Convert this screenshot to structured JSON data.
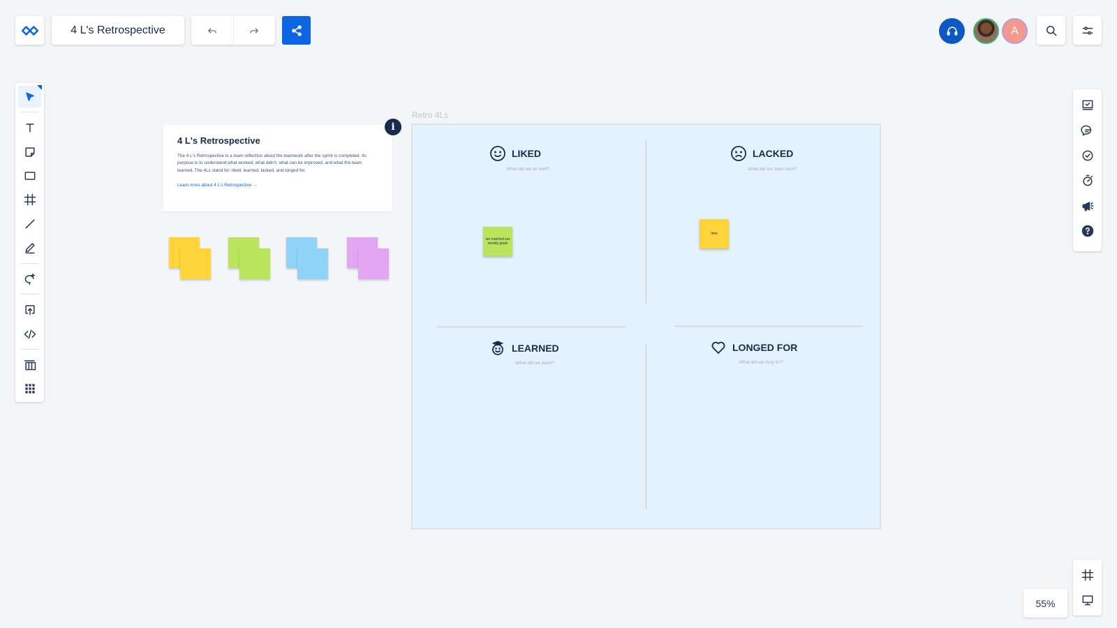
{
  "header": {
    "board_title": "4 L's Retrospective",
    "avatar_initial": "A"
  },
  "zoom_level": "55%",
  "description": {
    "title": "4 L's Retrospective",
    "body": "The 4 L's Retrospective is a team reflection about the teamwork after the sprint is completed. Its purpose is to understand what worked, what didn't, what can be improved, and what the team learned. The 4Ls stand for: liked, learned, lacked, and longed for.",
    "link": "Learn more about 4 L's Retrospective →"
  },
  "sticky_stack_colors": [
    "#ffd43b",
    "#b9e45c",
    "#8fd3f7",
    "#e2a6f2"
  ],
  "board": {
    "label": "Retro 4Ls",
    "background": "#e3f2fd",
    "quadrants": [
      {
        "title": "LIKED",
        "prompt": "What did we do well?",
        "icon": "smile-icon"
      },
      {
        "title": "LACKED",
        "prompt": "What did our team lack?",
        "icon": "frown-icon"
      },
      {
        "title": "LEARNED",
        "prompt": "What did we learn?",
        "icon": "graduate-icon"
      },
      {
        "title": "LONGED FOR",
        "prompt": "What did we long for?",
        "icon": "heart-icon"
      }
    ],
    "notes": [
      {
        "text": "we reached our weekly goals",
        "color": "#b9e45c",
        "quadrant": "LIKED"
      },
      {
        "text": "time",
        "color": "#ffd43b",
        "quadrant": "LACKED"
      }
    ]
  },
  "accent_color": "#0c66e4"
}
